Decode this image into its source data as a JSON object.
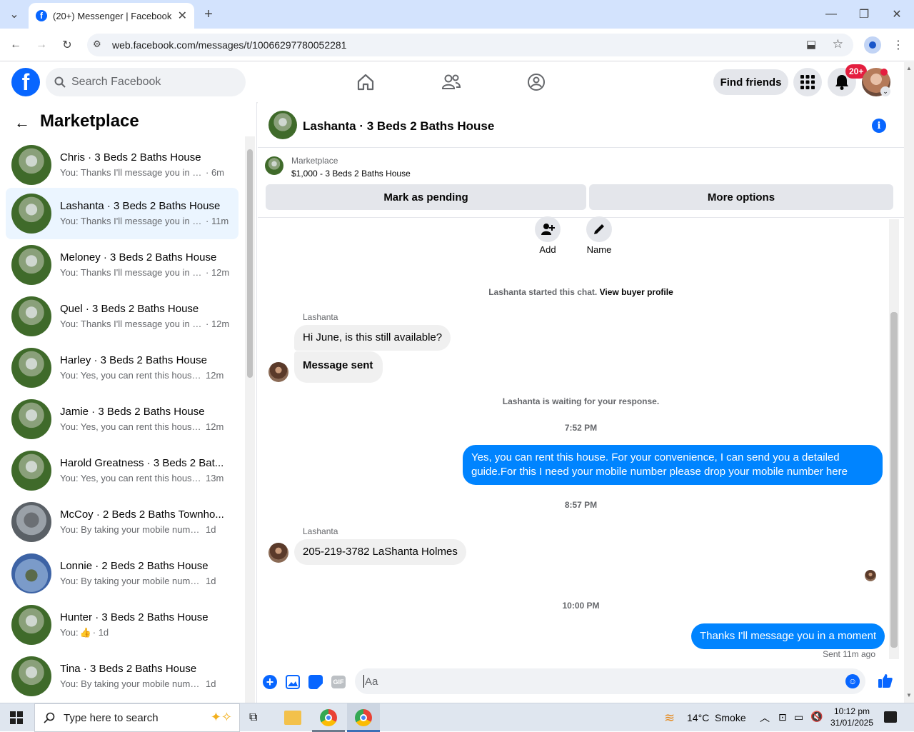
{
  "browser": {
    "tab_title": "(20+) Messenger | Facebook",
    "url": "web.facebook.com/messages/t/10066297780052281"
  },
  "header": {
    "search_placeholder": "Search Facebook",
    "find_friends": "Find friends",
    "notif_badge": "20+"
  },
  "sidebar": {
    "title": "Marketplace",
    "conversations": [
      {
        "name": "Chris · 3 Beds 2 Baths House",
        "preview": "You: Thanks I'll message you in a ...",
        "time": "· 6m"
      },
      {
        "name": "Lashanta · 3 Beds 2 Baths House",
        "preview": "You: Thanks I'll message you in a...",
        "time": "· 11m"
      },
      {
        "name": "Meloney · 3 Beds 2 Baths House",
        "preview": "You: Thanks I'll message you in a...",
        "time": "· 12m"
      },
      {
        "name": "Quel · 3 Beds 2 Baths House",
        "preview": "You: Thanks I'll message you in a...",
        "time": "· 12m"
      },
      {
        "name": "Harley · 3 Beds 2 Baths House",
        "preview": "You: Yes, you can rent this house....",
        "time": "12m"
      },
      {
        "name": "Jamie · 3 Beds 2 Baths House",
        "preview": "You: Yes, you can rent this house....",
        "time": "12m"
      },
      {
        "name": "Harold Greatness · 3 Beds 2 Bat...",
        "preview": "You: Yes, you can rent this house....",
        "time": "13m"
      },
      {
        "name": "McCoy · 2 Beds 2 Baths Townho...",
        "preview": "You: By taking your mobile number...",
        "time": "1d"
      },
      {
        "name": "Lonnie · 2 Beds 2 Baths House",
        "preview": "You: By taking your mobile number...",
        "time": "1d"
      },
      {
        "name": "Hunter · 3 Beds 2 Baths House",
        "preview": "You:",
        "time": "· 1d"
      },
      {
        "name": "Tina · 3 Beds 2 Baths House",
        "preview": "You: By taking your mobile number...",
        "time": "1d"
      }
    ]
  },
  "chat": {
    "title": "Lashanta · 3 Beds 2 Baths House",
    "listing_source": "Marketplace",
    "listing_title": "$1,000 - 3 Beds 2 Baths House",
    "mark_pending": "Mark as pending",
    "more_options": "More options",
    "add_label": "Add",
    "name_label": "Name",
    "started_text": "Lashanta started this chat.",
    "view_profile": "View buyer profile",
    "sender_name": "Lashanta",
    "msg1": "Hi June, is this still available?",
    "msg2": "Message sent",
    "waiting": "Lashanta is waiting for your response.",
    "time1": "7:52 PM",
    "out1": "Yes, you can rent this house. For your convenience, I can send you a detailed guide.For this I need your mobile number please drop your mobile number here",
    "time2": "8:57 PM",
    "msg3": "205-219-3782 LaShanta Holmes",
    "time3": "10:00 PM",
    "out2": "Thanks I'll message you in a moment",
    "sent_status": "Sent 11m ago",
    "composer_placeholder": "Aa",
    "gif_label": "GIF"
  },
  "taskbar": {
    "search_placeholder": "Type here to search",
    "weather": "14°C  Smoke",
    "time": "10:12 pm",
    "date": "31/01/2025"
  },
  "colors": {
    "fb_blue": "#0866ff",
    "messenger_blue": "#0084ff",
    "active_row": "#ebf5ff"
  }
}
